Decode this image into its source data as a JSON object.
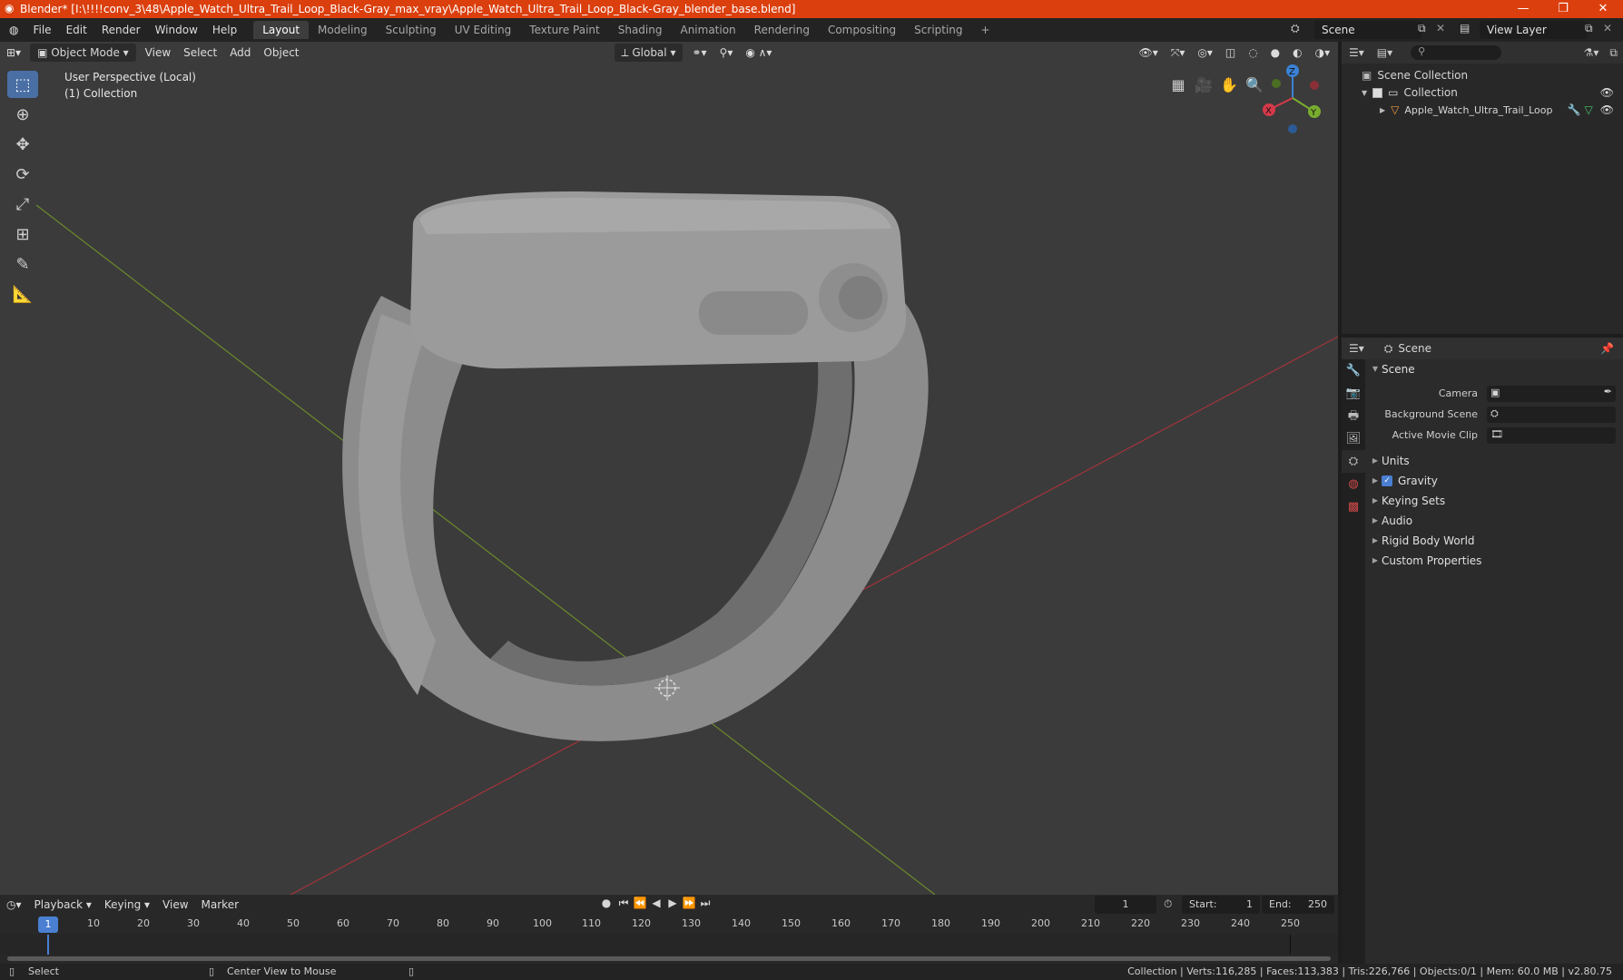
{
  "window": {
    "title": "Blender* [I:\\!!!!conv_3\\48\\Apple_Watch_Ultra_Trail_Loop_Black-Gray_max_vray\\Apple_Watch_Ultra_Trail_Loop_Black-Gray_blender_base.blend]",
    "minimize": "—",
    "restore": "❐",
    "close": "✕"
  },
  "menu": [
    "File",
    "Edit",
    "Render",
    "Window",
    "Help"
  ],
  "workspaces": [
    "Layout",
    "Modeling",
    "Sculpting",
    "UV Editing",
    "Texture Paint",
    "Shading",
    "Animation",
    "Rendering",
    "Compositing",
    "Scripting"
  ],
  "workspace_add": "+",
  "scene_name": "Scene",
  "view_layer": "View Layer",
  "viewport": {
    "mode": "Object Mode",
    "menus": [
      "View",
      "Select",
      "Add",
      "Object"
    ],
    "orientation": "Global",
    "perspective_label": "User Perspective (Local)",
    "collection_label": "(1) Collection",
    "gizmo": {
      "z": "Z",
      "x": "X",
      "y": "Y"
    }
  },
  "outliner": {
    "root": "Scene Collection",
    "collection": "Collection",
    "object": "Apple_Watch_Ultra_Trail_Loop"
  },
  "properties": {
    "context": "Scene",
    "panel": "Scene",
    "camera_label": "Camera",
    "background_scene_label": "Background Scene",
    "active_movie_clip_label": "Active Movie Clip",
    "sections": [
      "Units",
      "Gravity",
      "Keying Sets",
      "Audio",
      "Rigid Body World",
      "Custom Properties"
    ]
  },
  "timeline": {
    "menus": [
      "Playback",
      "Keying",
      "View",
      "Marker"
    ],
    "current_frame": "1",
    "start_label": "Start:",
    "start": "1",
    "end_label": "End:",
    "end": "250",
    "ticks": [
      "10",
      "20",
      "30",
      "40",
      "50",
      "60",
      "70",
      "80",
      "90",
      "100",
      "110",
      "120",
      "130",
      "140",
      "150",
      "160",
      "170",
      "180",
      "190",
      "200",
      "210",
      "220",
      "230",
      "240",
      "250"
    ]
  },
  "status": {
    "select": "Select",
    "center_view": "Center View to Mouse",
    "stats": "Collection | Verts:116,285 | Faces:113,383 | Tris:226,766 | Objects:0/1 | Mem: 60.0 MB | v2.80.75"
  }
}
